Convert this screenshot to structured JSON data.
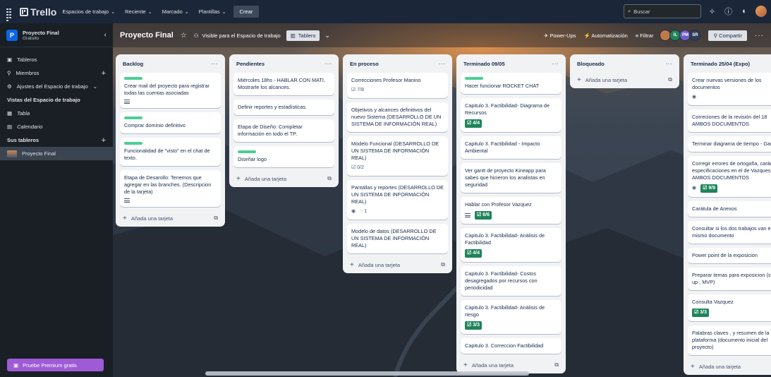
{
  "topbar": {
    "logo": "Trello",
    "menus": [
      "Espacios de trabajo",
      "Reciente",
      "Marcado",
      "Plantillas"
    ],
    "create": "Crear",
    "search_placeholder": "Buscar"
  },
  "sidebar": {
    "workspace_initial": "P",
    "workspace_name": "Proyecto Final",
    "workspace_plan": "Gratuito",
    "items": [
      {
        "label": "Tableros",
        "icon": "board-icon"
      },
      {
        "label": "Miembros",
        "icon": "members-icon"
      },
      {
        "label": "Ajustes del Espacio de trabajo",
        "icon": "settings-icon"
      }
    ],
    "views_title": "Vistas del Espacio de trabajo",
    "views": [
      {
        "label": "Tabla",
        "icon": "table-icon"
      },
      {
        "label": "Calendario",
        "icon": "calendar-icon"
      }
    ],
    "boards_title": "Sus tableros",
    "boards": [
      "Proyecto Final"
    ],
    "premium": "Pruebe Premium gratis"
  },
  "board_header": {
    "title": "Proyecto Final",
    "visibility": "Visible para el Espacio de trabajo",
    "view": "Tablero",
    "powerups": "Power-Ups",
    "automation": "Automatización",
    "filter": "Filtrar",
    "members": [
      {
        "initials": "",
        "color": "#c07a4a"
      },
      {
        "initials": "IL",
        "color": "#1f845a"
      },
      {
        "initials": "PM",
        "color": "#6e5dc6"
      },
      {
        "initials": "SR",
        "color": "#2c3e5d"
      }
    ],
    "share": "Compartir"
  },
  "add_card_label": "Añada una tarjeta",
  "lists": [
    {
      "title": "Backlog",
      "cards": [
        {
          "text": "Crear mail del proyecto para registrar todas las cuentas asociadas",
          "label": true,
          "desc": true
        },
        {
          "text": "Comprar dominio definitivo",
          "label": true
        },
        {
          "text": "Funcionalidad de \"visto\" en el chat de texto.",
          "label": true
        },
        {
          "text": "Etapa de Desarollo: Tenemos que agregar en las branches. (Descripcion de la tarjeta)",
          "desc": true
        }
      ]
    },
    {
      "title": "Pendientes",
      "cards": [
        {
          "text": "Miércoles 18hs - HABLAR CON MATI. Mostrarle los alcances."
        },
        {
          "text": "Definir reportes y estadísticas."
        },
        {
          "text": "Etapa de Diseño: Completar información en todo el TP."
        },
        {
          "text": "Diseñar logo",
          "label": true
        }
      ]
    },
    {
      "title": "En proceso",
      "cards": [
        {
          "text": "Correcciones Profesor Manino",
          "check": "7/8"
        },
        {
          "text": "Objetivos y alcances definitivos del nuevo Sistema (DESARROLLO DE UN SISTEMA DE INFORMACIÓN REAL)"
        },
        {
          "text": "Modelo Funcional (DESARROLLO DE UN SISTEMA DE INFORMACIÓN REAL)",
          "check": "0/2"
        },
        {
          "text": "Pantallas y reportes (DESARROLLO DE UN SISTEMA DE INFORMACIÓN REAL)",
          "watch": true,
          "comments": "1"
        },
        {
          "text": "Modelo de datos (DESARROLLO DE UN SISTEMA DE INFORMACIÓN REAL)"
        }
      ]
    },
    {
      "title": "Terminado 09/05",
      "cards": [
        {
          "text": "Hacer funcionar ROCKET CHAT",
          "label": true
        },
        {
          "text": "Capitulo 3. Factibilidad- Diagrama de Recursos",
          "check_done": "4/4"
        },
        {
          "text": "Capitulo 3. Factibilidad - Impacto Ambiental"
        },
        {
          "text": "Ver gantt de proyecto Kineapp para sabes que hicieron los analistas en seguridad"
        },
        {
          "text": "Hablar con Profesor Vazquez",
          "desc": true,
          "check_done": "6/6"
        },
        {
          "text": "Capitulo 3. Factibilidad- Análisis de Factibilidad",
          "check_done": "4/4"
        },
        {
          "text": "Capitulo 3. Factibilidad- Costos desagregados por recursos con periodicidad"
        },
        {
          "text": "Capitulo 3. Factibilidad- Análisis de riesgo",
          "check_done": "3/3"
        },
        {
          "text": "Capitulo 3. Correccion Factibilidad"
        }
      ]
    },
    {
      "title": "Bloqueado",
      "cards": []
    },
    {
      "title": "Terminado 25/04 (Expo)",
      "cards": [
        {
          "text": "Crear nuevas versiones de los documentos",
          "watch": true
        },
        {
          "text": "Correciones de la revisión del 18 AMBOS DOCUMENTOS"
        },
        {
          "text": "Terminar diagrama de tiempo - Gantt"
        },
        {
          "text": "Corregir errores de ortogafía, carártulas especificaciones en el de Vazques AMBOS DOCUMENTOS",
          "watch": true,
          "check_done": "9/9"
        },
        {
          "text": "Carátula de Anexos"
        },
        {
          "text": "Consultar si los dos trabajos van en el mismo documento"
        },
        {
          "text": "Power point de la exposicion"
        },
        {
          "text": "Preparar temas para exposicion (start-up , MVP)"
        },
        {
          "text": "Consulta Vazquez",
          "check_done": "3/3"
        },
        {
          "text": "Palabras claves , y resumen de la plataforma (documento inicial del proyecto)"
        }
      ]
    }
  ]
}
